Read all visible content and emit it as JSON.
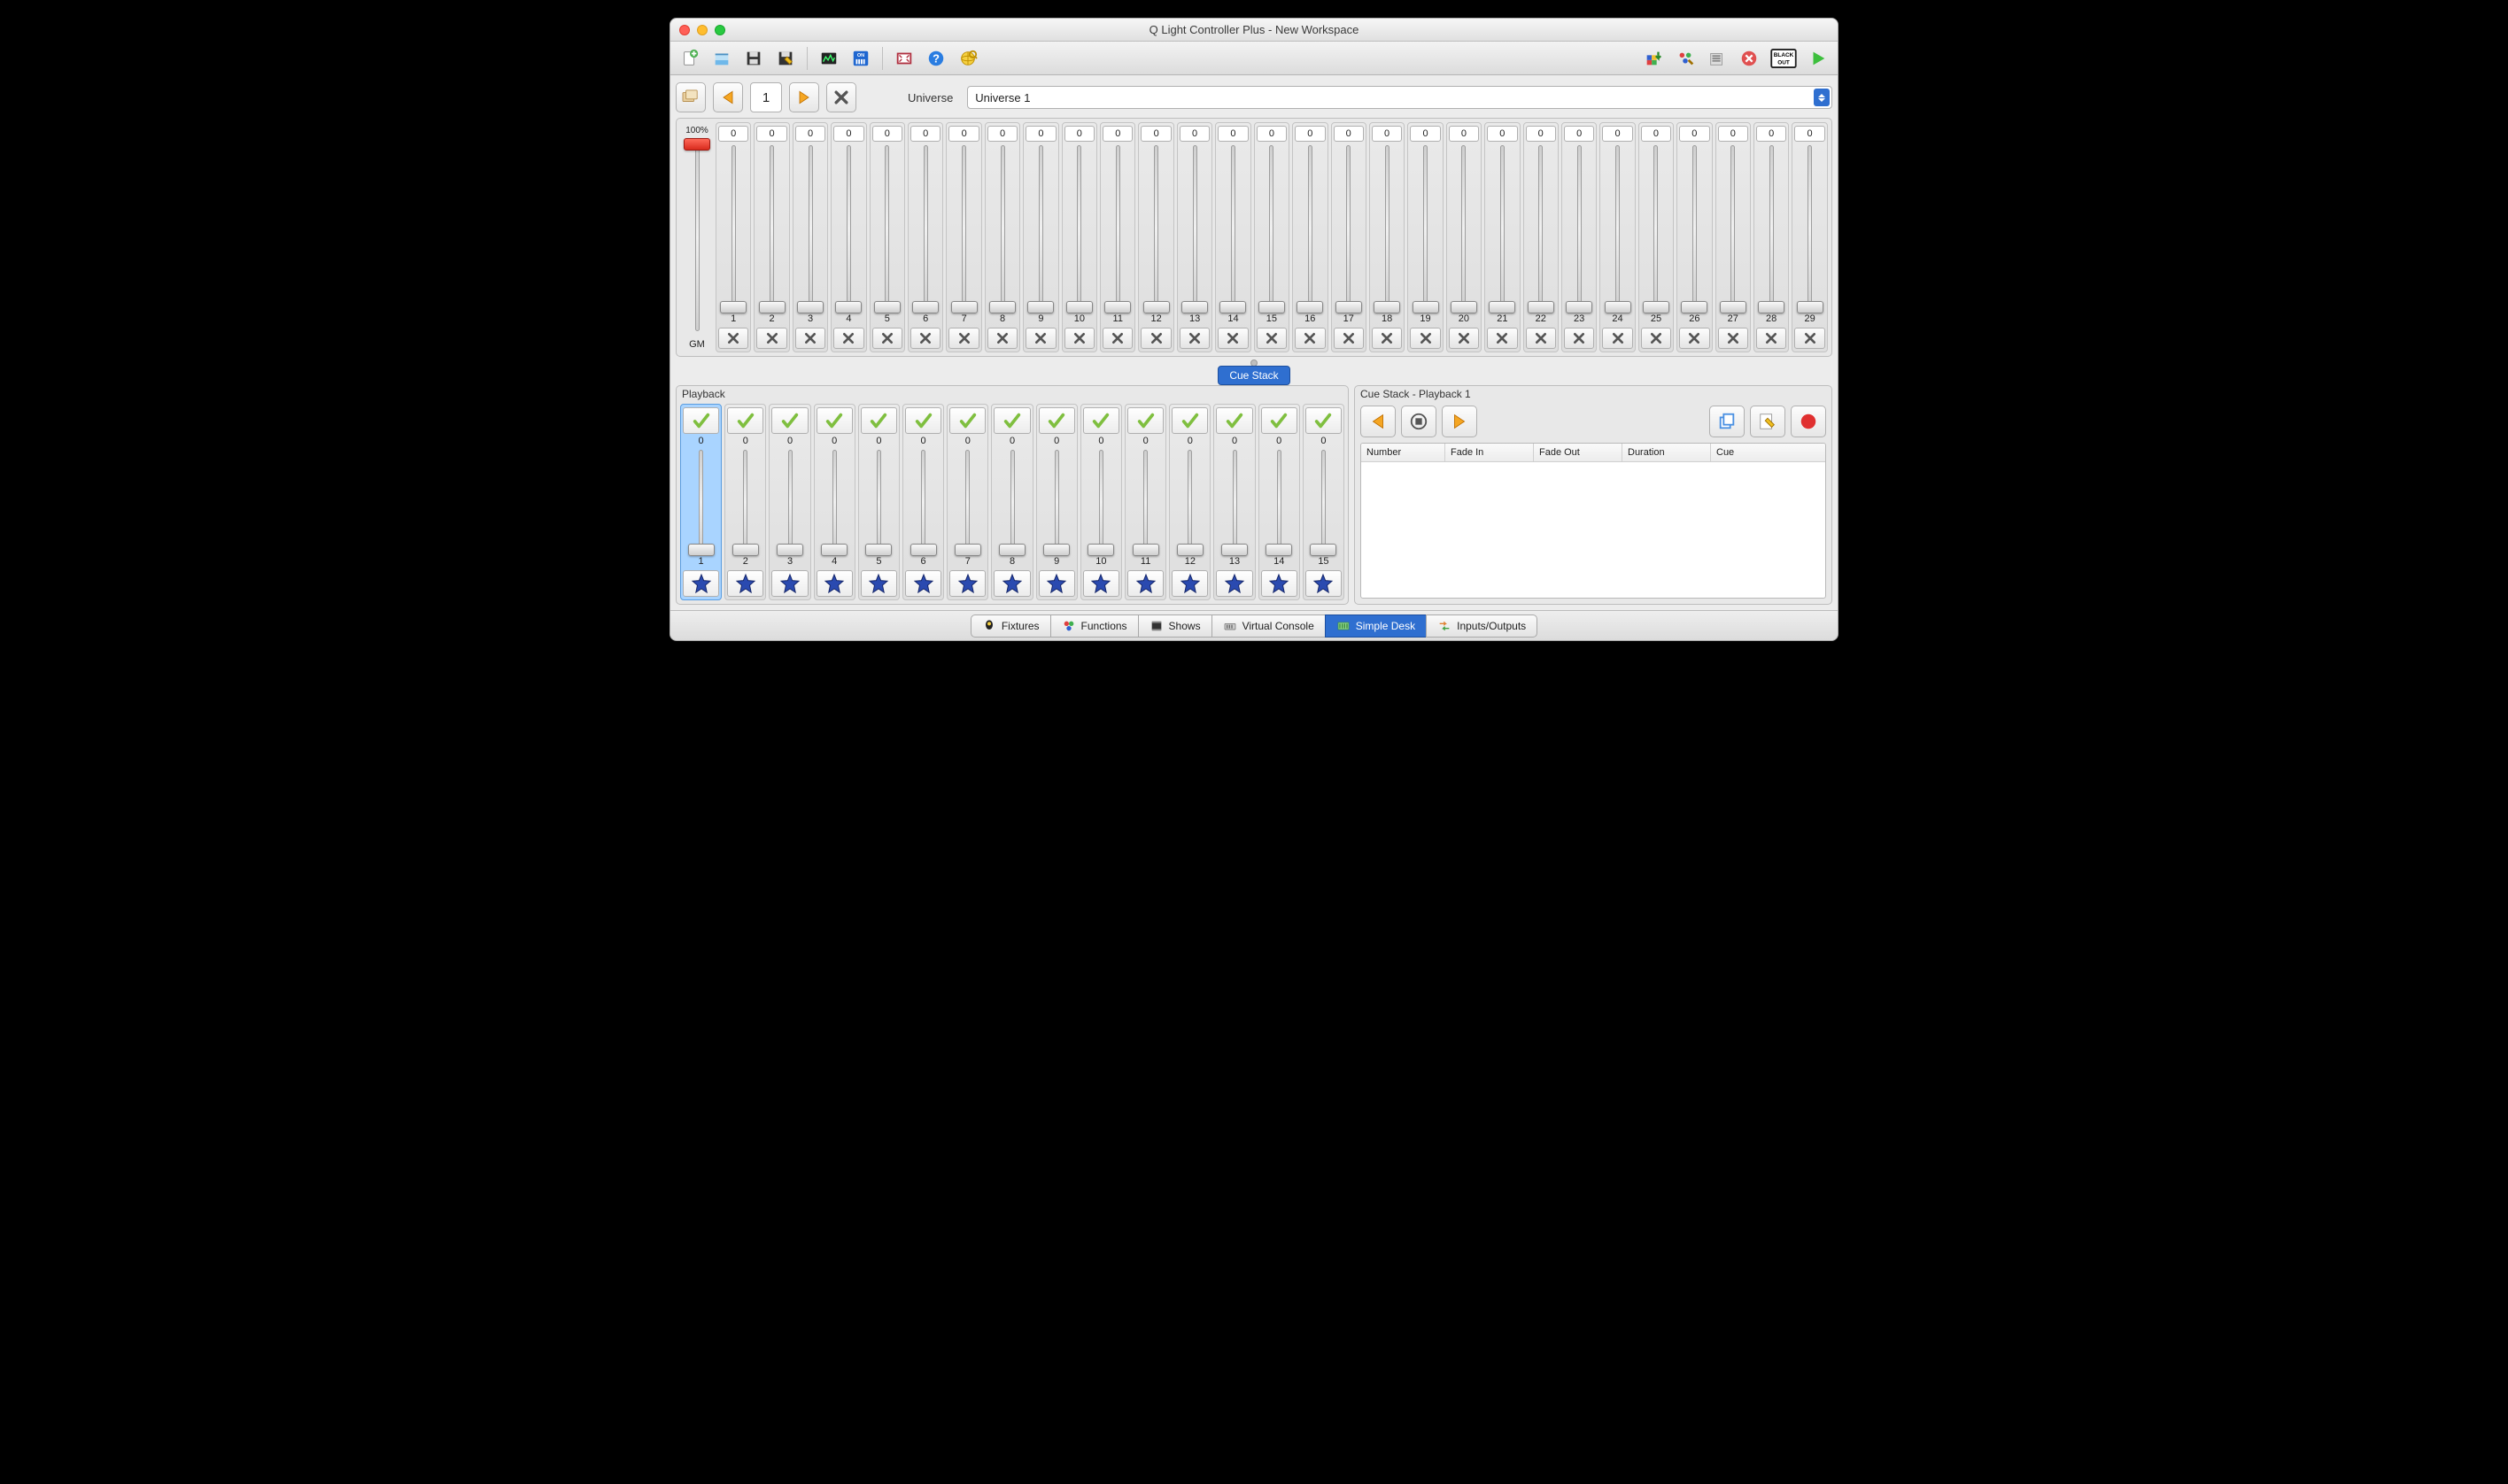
{
  "window": {
    "title": "Q Light Controller Plus - New Workspace"
  },
  "toolbar": {
    "new": "new",
    "open": "open",
    "save": "save",
    "saveas": "save-as",
    "monitor": "monitor",
    "dmx": "dmx",
    "fullscreen": "fullscreen",
    "help": "help",
    "web": "web",
    "addfix": "add-fixture",
    "fixbrush": "fixture-paint",
    "log": "log",
    "stopall": "stop-all",
    "blackout_label": "BLACK\nOUT",
    "run": "run"
  },
  "nav": {
    "page": "1",
    "universe_label": "Universe",
    "universe_value": "Universe 1"
  },
  "gm": {
    "top": "100%",
    "bottom": "GM"
  },
  "channels": {
    "count": 29,
    "value": "0"
  },
  "cue_chip": "Cue Stack",
  "playback": {
    "title": "Playback",
    "count": 15,
    "value": "0",
    "selected": 1
  },
  "cuestack": {
    "title": "Cue Stack - Playback 1",
    "cols": {
      "number": "Number",
      "fadein": "Fade In",
      "fadeout": "Fade Out",
      "duration": "Duration",
      "cue": "Cue"
    }
  },
  "tabs": {
    "fixtures": "Fixtures",
    "functions": "Functions",
    "shows": "Shows",
    "vc": "Virtual Console",
    "desk": "Simple Desk",
    "io": "Inputs/Outputs"
  }
}
